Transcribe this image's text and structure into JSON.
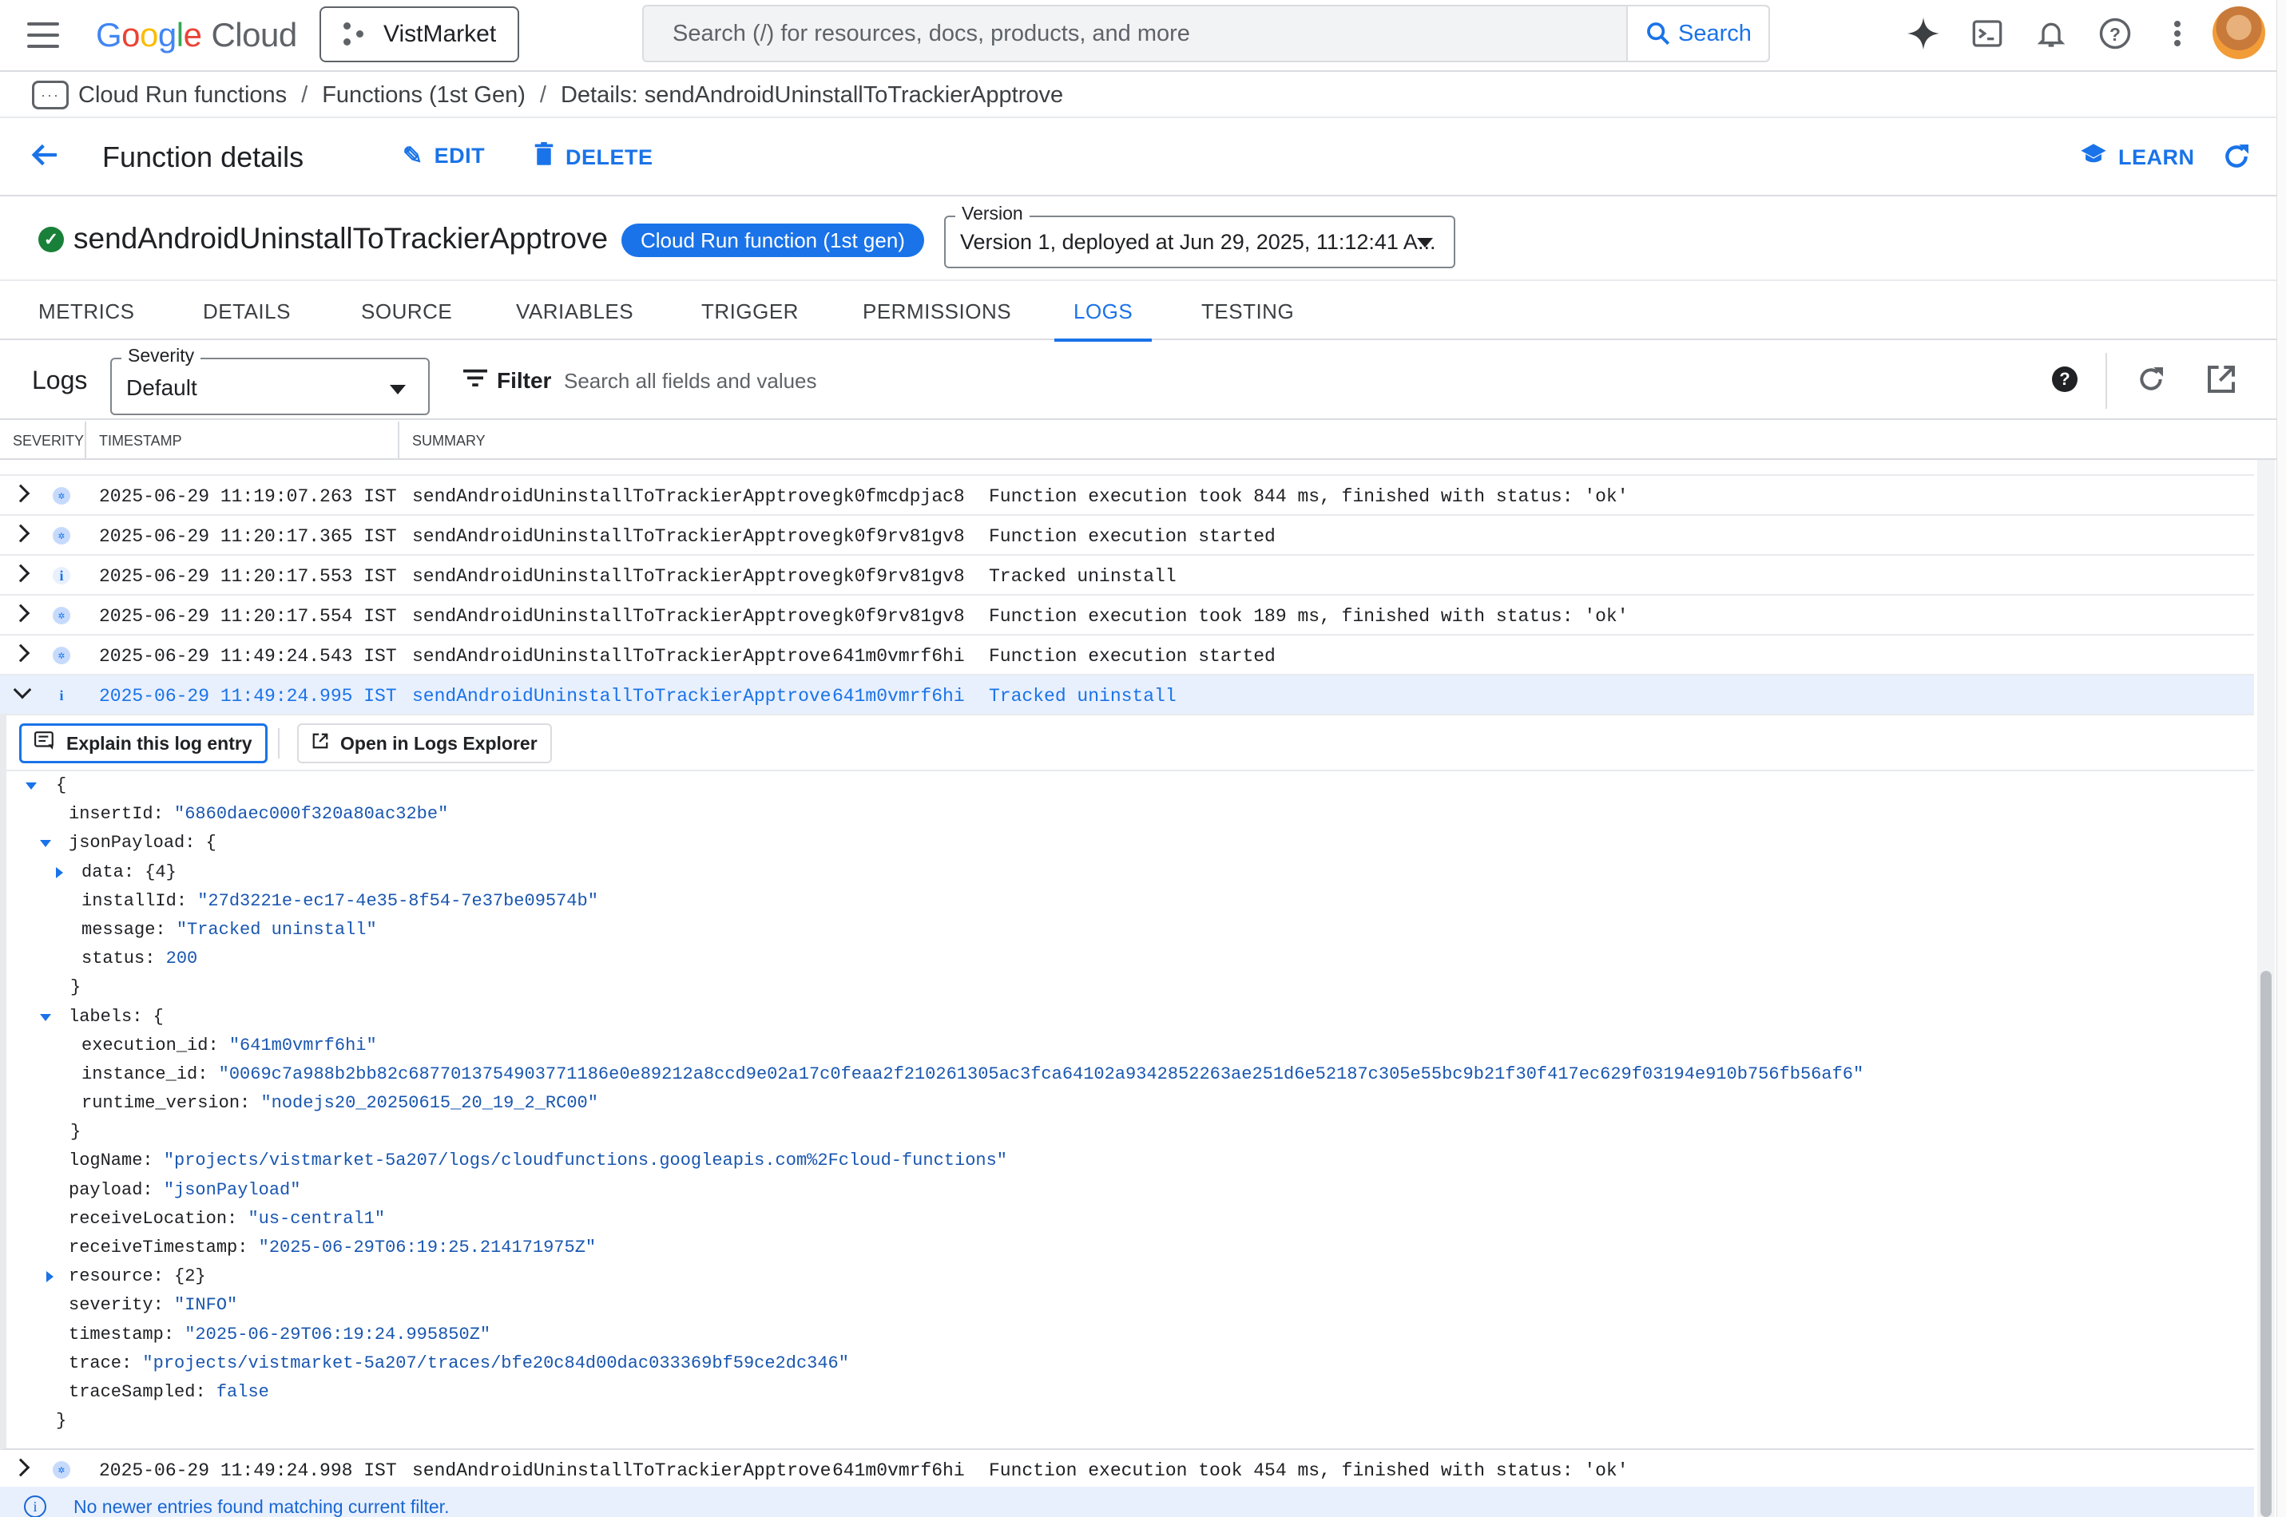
{
  "topbar": {
    "logo_google": "Google",
    "logo_cloud": "Cloud",
    "project": "VistMarket",
    "search_placeholder": "Search (/) for resources, docs, products, and more",
    "search_button": "Search"
  },
  "breadcrumb": {
    "items": [
      "Cloud Run functions",
      "Functions (1st Gen)",
      "Details: sendAndroidUninstallToTrackierApptrove"
    ]
  },
  "header": {
    "title": "Function details",
    "edit": "EDIT",
    "delete": "DELETE",
    "learn": "LEARN"
  },
  "function": {
    "name": "sendAndroidUninstallToTrackierApptrove",
    "chip": "Cloud Run function (1st gen)",
    "version_label": "Version",
    "version_value": "Version 1, deployed at Jun 29, 2025, 11:12:41 A..."
  },
  "tabs": [
    "METRICS",
    "DETAILS",
    "SOURCE",
    "VARIABLES",
    "TRIGGER",
    "PERMISSIONS",
    "LOGS",
    "TESTING"
  ],
  "active_tab": "LOGS",
  "logs_toolbar": {
    "title": "Logs",
    "severity_label": "Severity",
    "severity_value": "Default",
    "filter": "Filter",
    "search_placeholder": "Search all fields and values"
  },
  "table": {
    "headers": [
      "SEVERITY",
      "TIMESTAMP",
      "SUMMARY"
    ],
    "rows": [
      {
        "severity": "debug",
        "timestamp": "2025-06-29 11:19:07.263 IST",
        "function": "sendAndroidUninstallToTrackierApptrove",
        "exec": "gk0fmcdpjac8",
        "message": "Function execution took 844 ms, finished with status: 'ok'"
      },
      {
        "severity": "debug",
        "timestamp": "2025-06-29 11:20:17.365 IST",
        "function": "sendAndroidUninstallToTrackierApptrove",
        "exec": "gk0f9rv81gv8",
        "message": "Function execution started"
      },
      {
        "severity": "info",
        "timestamp": "2025-06-29 11:20:17.553 IST",
        "function": "sendAndroidUninstallToTrackierApptrove",
        "exec": "gk0f9rv81gv8",
        "message": "Tracked uninstall"
      },
      {
        "severity": "debug",
        "timestamp": "2025-06-29 11:20:17.554 IST",
        "function": "sendAndroidUninstallToTrackierApptrove",
        "exec": "gk0f9rv81gv8",
        "message": "Function execution took 189 ms, finished with status: 'ok'"
      },
      {
        "severity": "debug",
        "timestamp": "2025-06-29 11:49:24.543 IST",
        "function": "sendAndroidUninstallToTrackierApptrove",
        "exec": "641m0vmrf6hi",
        "message": "Function execution started"
      },
      {
        "severity": "info",
        "timestamp": "2025-06-29 11:49:24.995 IST",
        "function": "sendAndroidUninstallToTrackierApptrove",
        "exec": "641m0vmrf6hi",
        "message": "Tracked uninstall"
      }
    ],
    "last_row": {
      "severity": "debug",
      "timestamp": "2025-06-29 11:49:24.998 IST",
      "function": "sendAndroidUninstallToTrackierApptrove",
      "exec": "641m0vmrf6hi",
      "message": "Function execution took 454 ms, finished with status: 'ok'"
    }
  },
  "expanded": {
    "explain_button": "Explain this log entry",
    "open_button": "Open in Logs Explorer",
    "json": {
      "open_brace": "{",
      "insertId_key": "insertId",
      "insertId": "\"6860daec000f320a80ac32be\"",
      "jsonPayload_key": "jsonPayload",
      "obj_open": "{",
      "data_key": "data",
      "data_count": "{4}",
      "installId_key": "installId",
      "installId": "\"27d3221e-ec17-4e35-8f54-7e37be09574b\"",
      "message_key": "message",
      "message": "\"Tracked uninstall\"",
      "status_key": "status",
      "status": "200",
      "close_brace": "}",
      "labels_key": "labels",
      "execution_id_key": "execution_id",
      "execution_id": "\"641m0vmrf6hi\"",
      "instance_id_key": "instance_id",
      "instance_id": "\"0069c7a988b2bb82c687701375490377118 6e0e89212a8ccd9e02a17c0feaa2f210261305ac3fca64102a9342852263ae251d6e52187c305e55bc9b21f30f417ec629f03194e910b756fb56af6\"",
      "runtime_version_key": "runtime_version",
      "runtime_version": "\"nodejs20_20250615_20_19_2_RC00\"",
      "logName_key": "logName",
      "logName": "\"projects/vistmarket-5a207/logs/cloudfunctions.googleapis.com%2Fcloud-functions\"",
      "payload_key": "payload",
      "payload": "\"jsonPayload\"",
      "receiveLocation_key": "receiveLocation",
      "receiveLocation": "\"us-central1\"",
      "receiveTimestamp_key": "receiveTimestamp",
      "receiveTimestamp": "\"2025-06-29T06:19:25.214171975Z\"",
      "resource_key": "resource",
      "resource_count": "{2}",
      "severity_key": "severity",
      "severity": "\"INFO\"",
      "timestamp_key": "timestamp",
      "timestamp": "\"2025-06-29T06:19:24.995850Z\"",
      "trace_key": "trace",
      "trace": "\"projects/vistmarket-5a207/traces/bfe20c84d00dac033369bf59ce2dc346\"",
      "traceSampled_key": "traceSampled",
      "traceSampled": "false"
    }
  },
  "info_banner": "No newer entries found matching current filter.",
  "colors": {
    "accent": "#1a73e8",
    "success": "#188038",
    "selected_row": "#e8f0fe"
  },
  "icons": [
    "menu-icon",
    "project-icon",
    "search-icon",
    "gemini-icon",
    "terminal-icon",
    "bell-icon",
    "help-icon",
    "more-icon",
    "back-arrow-icon",
    "pencil-icon",
    "trash-icon",
    "school-icon",
    "refresh-icon",
    "check-circle-icon",
    "filter-icon",
    "external-link-icon",
    "info-icon"
  ]
}
